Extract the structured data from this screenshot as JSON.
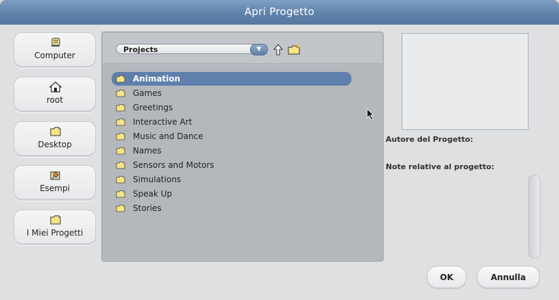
{
  "window": {
    "title": "Apri Progetto"
  },
  "shortcuts": [
    {
      "label": "Computer",
      "icon": "computer-icon"
    },
    {
      "label": "root",
      "icon": "home-icon"
    },
    {
      "label": "Desktop",
      "icon": "folder-icon"
    },
    {
      "label": "Esempi",
      "icon": "examples-icon"
    },
    {
      "label": "I Miei Progetti",
      "icon": "folder-icon"
    }
  ],
  "browser": {
    "location": "Projects",
    "items": [
      {
        "name": "Animation",
        "selected": true
      },
      {
        "name": "Games"
      },
      {
        "name": "Greetings"
      },
      {
        "name": "Interactive Art"
      },
      {
        "name": "Music and Dance"
      },
      {
        "name": "Names"
      },
      {
        "name": "Sensors and Motors"
      },
      {
        "name": "Simulations"
      },
      {
        "name": "Speak Up"
      },
      {
        "name": "Stories"
      }
    ]
  },
  "details": {
    "author_label": "Autore del Progetto:",
    "notes_label": "Note relative al progetto:"
  },
  "buttons": {
    "ok": "OK",
    "cancel": "Annulla"
  },
  "colors": {
    "titlebar": "#6488b0",
    "selection": "#5f7fac",
    "folder": "#f3e27a"
  }
}
